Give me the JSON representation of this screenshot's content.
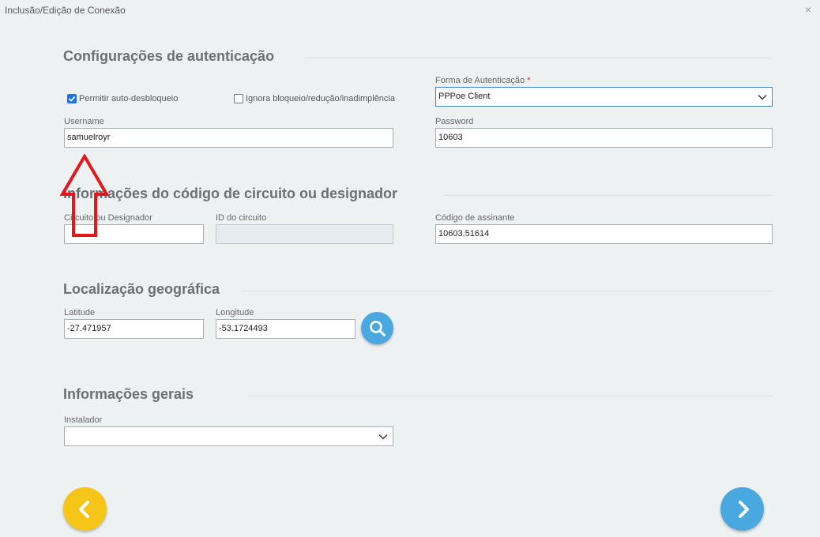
{
  "window": {
    "title": "Inclusão/Edição de Conexão",
    "close_glyph": "×"
  },
  "auth": {
    "section_title": "Configurações de autenticação",
    "checkbox_unblock": {
      "label": "Permitir auto-desbloqueio",
      "checked": true
    },
    "checkbox_ignore": {
      "label": "Ignora bloqueio/redução/inadimplência",
      "checked": false
    },
    "auth_method": {
      "label": "Forma de Autenticação",
      "required_mark": "*",
      "value": "PPPoe Client"
    },
    "username": {
      "label": "Username",
      "value": "samuelroyr"
    },
    "password": {
      "label": "Password",
      "value": "10603"
    }
  },
  "circuit": {
    "section_title": "Informações do código de circuito ou designador",
    "designator": {
      "label": "Circuito ou Designador",
      "value": ""
    },
    "circuit_id": {
      "label": "ID do circuito",
      "value": ""
    },
    "subscriber_code": {
      "label": "Código de assinante",
      "value": "10603.51614"
    }
  },
  "geo": {
    "section_title": "Localização geográfica",
    "latitude": {
      "label": "Latitude",
      "value": "-27.471957"
    },
    "longitude": {
      "label": "Longitude",
      "value": "-53.1724493"
    },
    "search_icon": "search-icon"
  },
  "general": {
    "section_title": "Informações gerais",
    "installer": {
      "label": "Instalador",
      "value": ""
    }
  },
  "nav": {
    "back_icon": "chevron-left-icon",
    "next_icon": "chevron-right-icon"
  },
  "colors": {
    "back_button": "#f5c518",
    "next_button": "#4aa8e0",
    "search_button": "#4aa8e0",
    "annotation_arrow": "#e0191f",
    "checkbox_checked": "#1a73e8"
  }
}
